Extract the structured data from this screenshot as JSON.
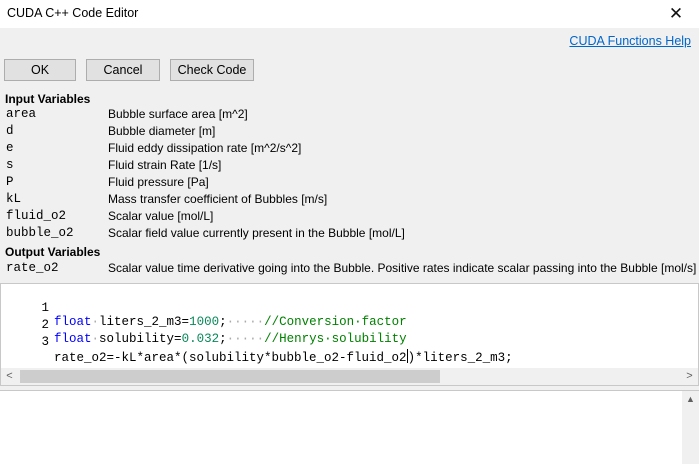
{
  "window": {
    "title": "CUDA C++ Code Editor",
    "close_glyph": "✕"
  },
  "help_link": "CUDA Functions Help",
  "buttons": {
    "ok": "OK",
    "cancel": "Cancel",
    "check": "Check Code"
  },
  "input_variables": {
    "title": "Input Variables",
    "items": [
      {
        "name": "area",
        "desc": "Bubble surface area [m^2]"
      },
      {
        "name": "d",
        "desc": "Bubble diameter [m]"
      },
      {
        "name": "e",
        "desc": "Fluid eddy dissipation rate [m^2/s^2]"
      },
      {
        "name": "s",
        "desc": "Fluid strain Rate [1/s]"
      },
      {
        "name": "P",
        "desc": "Fluid pressure [Pa]"
      },
      {
        "name": "kL",
        "desc": "Mass transfer coefficient of Bubbles [m/s]"
      },
      {
        "name": "fluid_o2",
        "desc": "Scalar value [mol/L]"
      },
      {
        "name": "bubble_o2",
        "desc": "Scalar field value currently present in the Bubble [mol/L]"
      }
    ]
  },
  "output_variables": {
    "title": "Output Variables",
    "items": [
      {
        "name": "rate_o2",
        "desc": "Scalar value time derivative going into the Bubble. Positive rates indicate scalar passing into the Bubble [mol/s]"
      }
    ]
  },
  "code": {
    "line_numbers": [
      "1",
      "2",
      "3"
    ],
    "line1": {
      "kw": "float",
      "ws1": "·",
      "ident": "liters_2_m3",
      "eq": "=",
      "num": "1000",
      "semi": ";",
      "ws2": "·····",
      "comment": "//Conversion·factor"
    },
    "line2": {
      "kw": "float",
      "ws1": "·",
      "ident": "solubility",
      "eq": "=",
      "num": "0.032",
      "semi": ";",
      "ws2": "·····",
      "comment": "//Henrys·solubility"
    },
    "line3": {
      "before_caret": "rate_o2=-kL*area*(solubility*bubble_o2-fluid_o2",
      "after_caret": ")*liters_2_m3;"
    }
  },
  "scroll_glyphs": {
    "left": "<",
    "right": ">",
    "up": "▲"
  }
}
